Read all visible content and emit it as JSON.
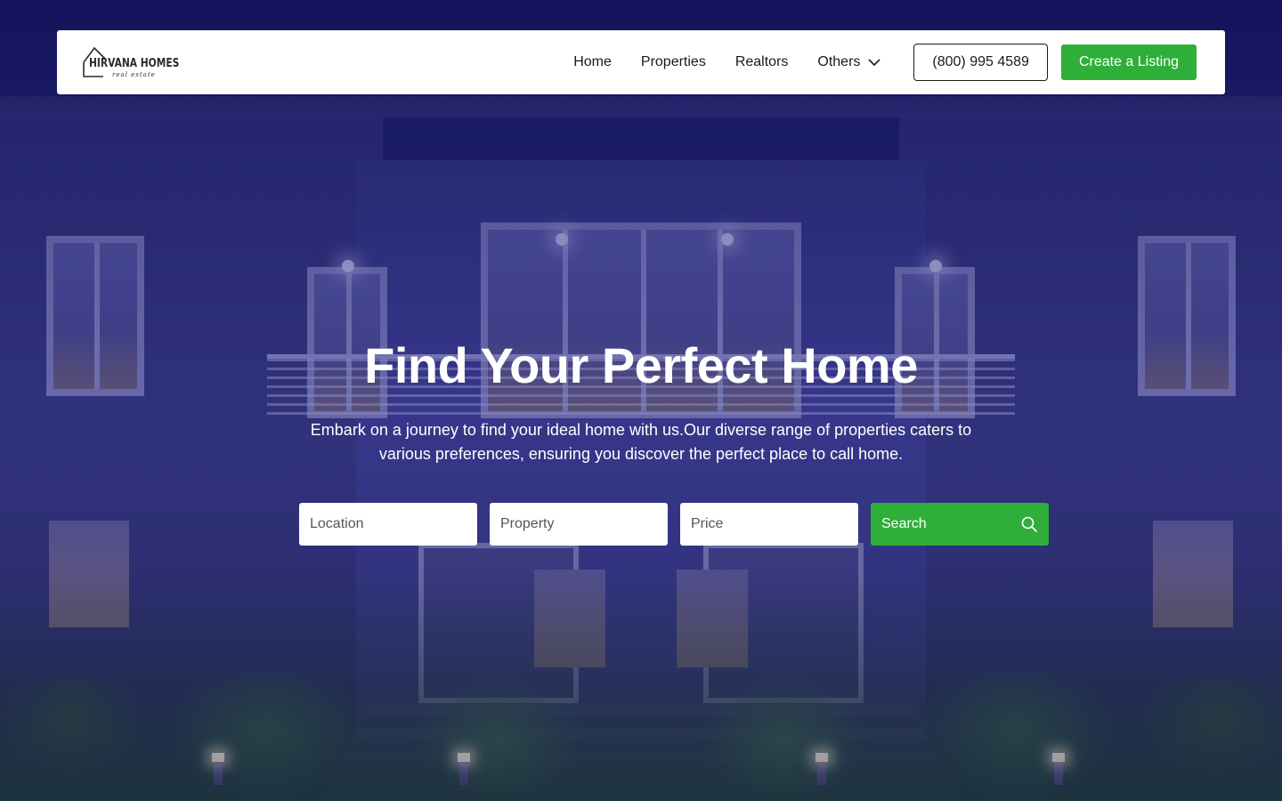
{
  "brand": {
    "name": "HIRVANA HOMES",
    "tagline": "real estate"
  },
  "nav": {
    "links": [
      "Home",
      "Properties",
      "Realtors"
    ],
    "dropdown_label": "Others",
    "phone": "(800) 995 4589",
    "cta": "Create a Listing"
  },
  "hero": {
    "title": "Find Your Perfect Home",
    "subtitle": "Embark on a journey to find your ideal home with us.Our diverse range of properties caters to various preferences, ensuring you discover the perfect place to call home."
  },
  "search": {
    "location_placeholder": "Location",
    "property_placeholder": "Property",
    "price_placeholder": "Price",
    "button_label": "Search"
  },
  "colors": {
    "accent": "#2fae3a",
    "overlay": "#14165a",
    "text": "#1a1a1a"
  },
  "icons": {
    "logo": "house-outline-icon",
    "dropdown": "chevron-down-icon",
    "search": "search-icon"
  }
}
